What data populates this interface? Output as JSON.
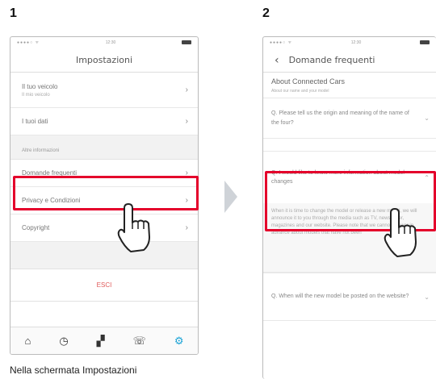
{
  "steps": [
    {
      "number": "1",
      "caption": "Nella schermata Impostazioni"
    },
    {
      "number": "2"
    }
  ],
  "screen1": {
    "status_time": "12:30",
    "title": "Impostazioni",
    "items": [
      {
        "label": "Il tuo veicolo",
        "sublabel": "Il mio veicolo"
      },
      {
        "label": "I tuoi dati"
      }
    ],
    "section_header": "Altre informazioni",
    "items2": [
      {
        "label": "Domande frequenti"
      },
      {
        "label": "Privacy e Condizioni"
      },
      {
        "label": "Copyright"
      }
    ],
    "exit_label": "ESCI",
    "tabs": [
      "home-icon",
      "history-icon",
      "cars-icon",
      "phone-icon",
      "settings-icon"
    ]
  },
  "screen2": {
    "status_time": "12:30",
    "title": "Domande frequenti",
    "section_title": "About Connected Cars",
    "section_desc": "About our name and your model",
    "questions": [
      {
        "text": "Q. Please tell us the origin and meaning of the name of the four?"
      },
      {
        "text": "Q. I would like to know more information about model changes"
      },
      {
        "text": "Q. When will the new model be posted on the website?"
      }
    ],
    "answer_text": "When it is time to change the model or release a new model, we will announce it to you through the media such as TV, newspaper, magazines and our website. Please note that we cannot answer in advance about models that have not been"
  },
  "colors": {
    "highlight": "#e4002b",
    "accent": "#1aa3d6",
    "exit": "#e05a5a"
  }
}
